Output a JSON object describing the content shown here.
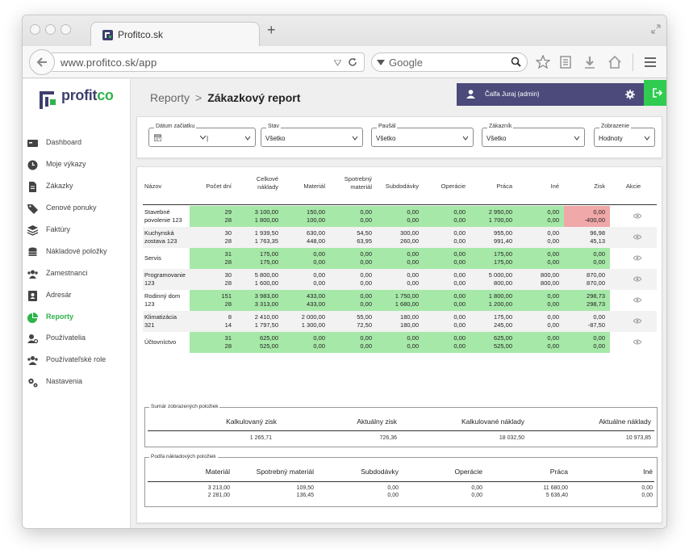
{
  "browser": {
    "tab_title": "Profitco.sk",
    "url": "www.profitco.sk/app",
    "search_placeholder": "Google"
  },
  "app": {
    "logo_text_main": "profit",
    "logo_text_accent": "co",
    "colors": {
      "brand": "#3d3f6e",
      "accent": "#2fb34a",
      "userbar": "#4b4a7a",
      "positive": "#a6e8a8",
      "negative": "#f0a8a8"
    }
  },
  "sidebar": {
    "items": [
      {
        "label": "Dashboard",
        "icon": "dashboard-icon"
      },
      {
        "label": "Moje výkazy",
        "icon": "clock-icon"
      },
      {
        "label": "Zákazky",
        "icon": "document-icon"
      },
      {
        "label": "Cenové ponuky",
        "icon": "tag-icon"
      },
      {
        "label": "Faktúry",
        "icon": "layers-icon"
      },
      {
        "label": "Nákladové položky",
        "icon": "coins-icon"
      },
      {
        "label": "Zamestnanci",
        "icon": "users-icon"
      },
      {
        "label": "Adresár",
        "icon": "address-book-icon"
      },
      {
        "label": "Reporty",
        "icon": "pie-chart-icon"
      },
      {
        "label": "Používatelia",
        "icon": "user-gear-icon"
      },
      {
        "label": "Používateľské role",
        "icon": "user-group-icon"
      },
      {
        "label": "Nastavenia",
        "icon": "cogs-icon"
      }
    ],
    "active": "Reporty"
  },
  "header": {
    "breadcrumb_parent": "Reporty",
    "breadcrumb_separator": ">",
    "breadcrumb_current": "Zákazkový report",
    "user_label": "Čalfa Juraj (admin)"
  },
  "filters": {
    "date_label": "Dátum začiatku",
    "date_value": "|",
    "state_label": "Stav",
    "state_value": "Všetko",
    "flat_label": "Paušál",
    "flat_value": "Všetko",
    "customer_label": "Zákazník",
    "customer_value": "Všetko",
    "display_label": "Zobrazenie",
    "display_value": "Hodnoty"
  },
  "table": {
    "headers": {
      "name": "Názov",
      "days": [
        "Počet dní"
      ],
      "total": [
        "Celkové",
        "náklady"
      ],
      "material": [
        "Materiál"
      ],
      "consumable": [
        "Spotrebný",
        "materiál"
      ],
      "subcontract": [
        "Subdodávky"
      ],
      "operations": [
        "Operácie"
      ],
      "work": [
        "Práca"
      ],
      "other": [
        "Iné"
      ],
      "profit": [
        "Zisk"
      ],
      "actions": [
        "Akcie"
      ]
    },
    "rows": [
      {
        "name": [
          "Stavebné",
          "povolenie 123"
        ],
        "highlight": "green",
        "days": [
          "29",
          "28"
        ],
        "total": [
          "3 100,00",
          "1 800,00"
        ],
        "material": [
          "150,00",
          "100,00"
        ],
        "consumable": [
          "0,00",
          "0,00"
        ],
        "subcontract": [
          "0,00",
          "0,00"
        ],
        "operations": [
          "0,00",
          "0,00"
        ],
        "work": [
          "2 950,00",
          "1 700,00"
        ],
        "other": [
          "0,00",
          "0,00"
        ],
        "profit": [
          "0,00",
          "-400,00"
        ],
        "profit_flag": "red"
      },
      {
        "name": [
          "Kuchynská",
          "zostava 123"
        ],
        "highlight": "none",
        "days": [
          "30",
          "28"
        ],
        "total": [
          "1 939,50",
          "1 763,35"
        ],
        "material": [
          "630,00",
          "448,00"
        ],
        "consumable": [
          "54,50",
          "63,95"
        ],
        "subcontract": [
          "300,00",
          "260,00"
        ],
        "operations": [
          "0,00",
          "0,00"
        ],
        "work": [
          "955,00",
          "991,40"
        ],
        "other": [
          "0,00",
          "0,00"
        ],
        "profit": [
          "96,98",
          "45,13"
        ],
        "profit_flag": "none"
      },
      {
        "name": [
          "Servis"
        ],
        "highlight": "green",
        "days": [
          "31",
          "28"
        ],
        "total": [
          "175,00",
          "175,00"
        ],
        "material": [
          "0,00",
          "0,00"
        ],
        "consumable": [
          "0,00",
          "0,00"
        ],
        "subcontract": [
          "0,00",
          "0,00"
        ],
        "operations": [
          "0,00",
          "0,00"
        ],
        "work": [
          "175,00",
          "175,00"
        ],
        "other": [
          "0,00",
          "0,00"
        ],
        "profit": [
          "0,00",
          "0,00"
        ],
        "profit_flag": "green"
      },
      {
        "name": [
          "Programovanie",
          "123"
        ],
        "highlight": "none",
        "days": [
          "30",
          "28"
        ],
        "total": [
          "5 800,00",
          "1 600,00"
        ],
        "material": [
          "0,00",
          "0,00"
        ],
        "consumable": [
          "0,00",
          "0,00"
        ],
        "subcontract": [
          "0,00",
          "0,00"
        ],
        "operations": [
          "0,00",
          "0,00"
        ],
        "work": [
          "5 000,00",
          "800,00"
        ],
        "other": [
          "800,00",
          "800,00"
        ],
        "profit": [
          "870,00",
          "870,00"
        ],
        "profit_flag": "none"
      },
      {
        "name": [
          "Rodinný dom",
          "123"
        ],
        "highlight": "green",
        "days": [
          "151",
          "28"
        ],
        "total": [
          "3 983,00",
          "3 313,00"
        ],
        "material": [
          "433,00",
          "433,00"
        ],
        "consumable": [
          "0,00",
          "0,00"
        ],
        "subcontract": [
          "1 750,00",
          "1 680,00"
        ],
        "operations": [
          "0,00",
          "0,00"
        ],
        "work": [
          "1 800,00",
          "1 200,00"
        ],
        "other": [
          "0,00",
          "0,00"
        ],
        "profit": [
          "298,73",
          "298,73"
        ],
        "profit_flag": "green"
      },
      {
        "name": [
          "Klimatizácia",
          "321"
        ],
        "highlight": "none",
        "days": [
          "8",
          "14"
        ],
        "total": [
          "2 410,00",
          "1 797,50"
        ],
        "material": [
          "2 000,00",
          "1 300,00"
        ],
        "consumable": [
          "55,00",
          "72,50"
        ],
        "subcontract": [
          "180,00",
          "180,00"
        ],
        "operations": [
          "0,00",
          "0,00"
        ],
        "work": [
          "175,00",
          "245,00"
        ],
        "other": [
          "0,00",
          "0,00"
        ],
        "profit": [
          "0,00",
          "-87,50"
        ],
        "profit_flag": "none"
      },
      {
        "name": [
          "Účtovníctvo"
        ],
        "highlight": "green",
        "days": [
          "31",
          "28"
        ],
        "total": [
          "625,00",
          "525,00"
        ],
        "material": [
          "0,00",
          "0,00"
        ],
        "consumable": [
          "0,00",
          "0,00"
        ],
        "subcontract": [
          "0,00",
          "0,00"
        ],
        "operations": [
          "0,00",
          "0,00"
        ],
        "work": [
          "625,00",
          "525,00"
        ],
        "other": [
          "0,00",
          "0,00"
        ],
        "profit": [
          "0,00",
          "0,00"
        ],
        "profit_flag": "green"
      }
    ]
  },
  "summary": {
    "legend": "Sumár zobrazených položiek",
    "headers": [
      "Kalkulovaný zisk",
      "Aktuálny zisk",
      "Kalkulované náklady",
      "Aktuálne náklady"
    ],
    "values": [
      "1 265,71",
      "726,36",
      "18 032,50",
      "10 973,85"
    ]
  },
  "by_cost": {
    "legend": "Podľa nákladových položiek",
    "headers": [
      "Materiál",
      "Spotrebný materiál",
      "Subdodávky",
      "Operácie",
      "Práca",
      "Iné"
    ],
    "values": [
      [
        "3 213,00",
        "2 281,00"
      ],
      [
        "109,50",
        "136,45"
      ],
      [
        "0,00",
        "0,00"
      ],
      [
        "0,00",
        "0,00"
      ],
      [
        "11 680,00",
        "5 636,40"
      ],
      [
        "0,00",
        "0,00"
      ]
    ]
  }
}
